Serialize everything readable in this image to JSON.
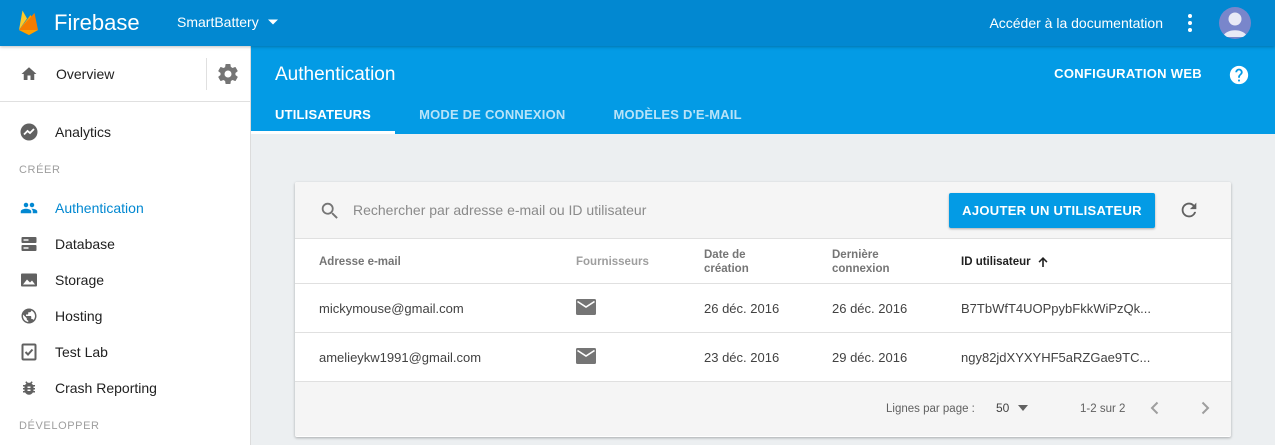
{
  "topbar": {
    "brand": "Firebase",
    "project": "SmartBattery",
    "doc_link": "Accéder à la documentation",
    "icons": {
      "logo": "firebase-flame-icon",
      "menu": "more-vert-icon",
      "avatar": "account-avatar-icon"
    }
  },
  "sidebar": {
    "overview_label": "Overview",
    "overview_icon": "home-icon",
    "settings_icon": "gear-icon",
    "items": [
      {
        "label": "Analytics",
        "icon": "analytics-icon"
      }
    ],
    "section_create": "CRÉER",
    "create_items": [
      {
        "label": "Authentication",
        "icon": "people-icon",
        "active": true
      },
      {
        "label": "Database",
        "icon": "database-icon"
      },
      {
        "label": "Storage",
        "icon": "image-icon"
      },
      {
        "label": "Hosting",
        "icon": "globe-icon"
      },
      {
        "label": "Test Lab",
        "icon": "checklist-icon"
      },
      {
        "label": "Crash Reporting",
        "icon": "bug-icon"
      }
    ],
    "section_develop": "DÉVELOPPER"
  },
  "header": {
    "title": "Authentication",
    "web_config": "CONFIGURATION WEB",
    "tabs": [
      {
        "label": "UTILISATEURS",
        "active": true
      },
      {
        "label": "MODE DE CONNEXION"
      },
      {
        "label": "MODÈLES D'E-MAIL"
      }
    ]
  },
  "users": {
    "search_placeholder": "Rechercher par adresse e-mail ou ID utilisateur",
    "add_button": "AJOUTER UN UTILISATEUR",
    "columns": {
      "email": "Adresse e-mail",
      "providers": "Fournisseurs",
      "created_1": "Date de",
      "created_2": "création",
      "last_1": "Dernière",
      "last_2": "connexion",
      "uid": "ID utilisateur"
    },
    "rows": [
      {
        "email": "mickymouse@gmail.com",
        "provider_icon": "email-icon",
        "created": "26 déc. 2016",
        "last": "26 déc. 2016",
        "uid": "B7TbWfT4UOPpybFkkWiPzQk..."
      },
      {
        "email": "amelieykw1991@gmail.com",
        "provider_icon": "email-icon",
        "created": "23 déc. 2016",
        "last": "29 déc. 2016",
        "uid": "ngy82jdXYXYHF5aRZGae9TC..."
      }
    ],
    "pagination": {
      "rows_label": "Lignes par page :",
      "rows_value": "50",
      "range": "1-2 sur 2"
    }
  },
  "colors": {
    "topbar": "#0288d1",
    "header": "#039be5",
    "accent": "#0288d1",
    "page_bg": "#eceff1"
  }
}
